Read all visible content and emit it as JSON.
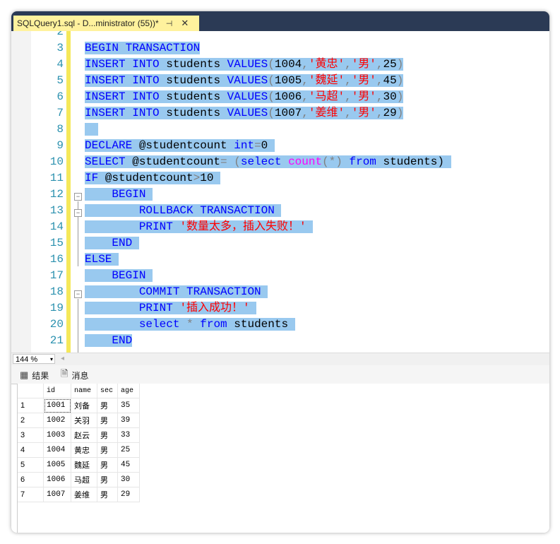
{
  "tab": {
    "title": "SQLQuery1.sql - D...ministrator (55))*",
    "pin": "⊣",
    "close": "✕"
  },
  "line_numbers": [
    "2",
    "3",
    "4",
    "5",
    "6",
    "7",
    "8",
    "9",
    "10",
    "11",
    "12",
    "13",
    "14",
    "15",
    "16",
    "17",
    "18",
    "19",
    "20",
    "21"
  ],
  "code_lines": [
    [],
    [
      {
        "t": "BEGIN TRANSACTION",
        "c": "kw",
        "s": true
      }
    ],
    [
      {
        "t": "INSERT",
        "c": "kw",
        "s": true
      },
      {
        "t": " ",
        "c": "id",
        "s": true
      },
      {
        "t": "INTO",
        "c": "kw",
        "s": true
      },
      {
        "t": " students ",
        "c": "id",
        "s": true
      },
      {
        "t": "VALUES",
        "c": "kw",
        "s": true
      },
      {
        "t": "(",
        "c": "op",
        "s": true
      },
      {
        "t": "1004",
        "c": "id",
        "s": true
      },
      {
        "t": ",",
        "c": "op",
        "s": true
      },
      {
        "t": "'黄忠'",
        "c": "str",
        "s": true
      },
      {
        "t": ",",
        "c": "op",
        "s": true
      },
      {
        "t": "'男'",
        "c": "str",
        "s": true
      },
      {
        "t": ",",
        "c": "op",
        "s": true
      },
      {
        "t": "25",
        "c": "id",
        "s": true
      },
      {
        "t": ")",
        "c": "op",
        "s": true
      }
    ],
    [
      {
        "t": "INSERT",
        "c": "kw",
        "s": true
      },
      {
        "t": " ",
        "c": "id",
        "s": true
      },
      {
        "t": "INTO",
        "c": "kw",
        "s": true
      },
      {
        "t": " students ",
        "c": "id",
        "s": true
      },
      {
        "t": "VALUES",
        "c": "kw",
        "s": true
      },
      {
        "t": "(",
        "c": "op",
        "s": true
      },
      {
        "t": "1005",
        "c": "id",
        "s": true
      },
      {
        "t": ",",
        "c": "op",
        "s": true
      },
      {
        "t": "'魏延'",
        "c": "str",
        "s": true
      },
      {
        "t": ",",
        "c": "op",
        "s": true
      },
      {
        "t": "'男'",
        "c": "str",
        "s": true
      },
      {
        "t": ",",
        "c": "op",
        "s": true
      },
      {
        "t": "45",
        "c": "id",
        "s": true
      },
      {
        "t": ")",
        "c": "op",
        "s": true
      }
    ],
    [
      {
        "t": "INSERT",
        "c": "kw",
        "s": true
      },
      {
        "t": " ",
        "c": "id",
        "s": true
      },
      {
        "t": "INTO",
        "c": "kw",
        "s": true
      },
      {
        "t": " students ",
        "c": "id",
        "s": true
      },
      {
        "t": "VALUES",
        "c": "kw",
        "s": true
      },
      {
        "t": "(",
        "c": "op",
        "s": true
      },
      {
        "t": "1006",
        "c": "id",
        "s": true
      },
      {
        "t": ",",
        "c": "op",
        "s": true
      },
      {
        "t": "'马超'",
        "c": "str",
        "s": true
      },
      {
        "t": ",",
        "c": "op",
        "s": true
      },
      {
        "t": "'男'",
        "c": "str",
        "s": true
      },
      {
        "t": ",",
        "c": "op",
        "s": true
      },
      {
        "t": "30",
        "c": "id",
        "s": true
      },
      {
        "t": ")",
        "c": "op",
        "s": true
      }
    ],
    [
      {
        "t": "INSERT",
        "c": "kw",
        "s": true
      },
      {
        "t": " ",
        "c": "id",
        "s": true
      },
      {
        "t": "INTO",
        "c": "kw",
        "s": true
      },
      {
        "t": " students ",
        "c": "id",
        "s": true
      },
      {
        "t": "VALUES",
        "c": "kw",
        "s": true
      },
      {
        "t": "(",
        "c": "op",
        "s": true
      },
      {
        "t": "1007",
        "c": "id",
        "s": true
      },
      {
        "t": ",",
        "c": "op",
        "s": true
      },
      {
        "t": "'姜维'",
        "c": "str",
        "s": true
      },
      {
        "t": ",",
        "c": "op",
        "s": true
      },
      {
        "t": "'男'",
        "c": "str",
        "s": true
      },
      {
        "t": ",",
        "c": "op",
        "s": true
      },
      {
        "t": "29",
        "c": "id",
        "s": true
      },
      {
        "t": ")",
        "c": "op",
        "s": true
      }
    ],
    [
      {
        "t": "  ",
        "c": "id",
        "s": true
      }
    ],
    [
      {
        "t": "DECLARE",
        "c": "kw",
        "s": true
      },
      {
        "t": " @studentcount ",
        "c": "id",
        "s": true
      },
      {
        "t": "int",
        "c": "kw",
        "s": true
      },
      {
        "t": "=",
        "c": "op",
        "s": true
      },
      {
        "t": "0 ",
        "c": "id",
        "s": true
      }
    ],
    [
      {
        "t": "SELECT",
        "c": "kw",
        "s": true
      },
      {
        "t": " @studentcount",
        "c": "id",
        "s": true
      },
      {
        "t": "= (",
        "c": "op",
        "s": true
      },
      {
        "t": "select",
        "c": "kw",
        "s": true
      },
      {
        "t": " ",
        "c": "id",
        "s": true
      },
      {
        "t": "count",
        "c": "fn",
        "s": true
      },
      {
        "t": "(*)",
        "c": "op",
        "s": true
      },
      {
        "t": " ",
        "c": "id",
        "s": true
      },
      {
        "t": "from",
        "c": "kw",
        "s": true
      },
      {
        "t": " students) ",
        "c": "id",
        "s": true
      }
    ],
    [
      {
        "t": "IF",
        "c": "kw",
        "s": true
      },
      {
        "t": " @studentcount",
        "c": "id",
        "s": true
      },
      {
        "t": ">",
        "c": "op",
        "s": true
      },
      {
        "t": "10 ",
        "c": "id",
        "s": true
      }
    ],
    [
      {
        "t": "    ",
        "c": "id",
        "s": true
      },
      {
        "t": "BEGIN",
        "c": "kw",
        "s": true
      },
      {
        "t": " ",
        "c": "id",
        "s": true
      }
    ],
    [
      {
        "t": "        ",
        "c": "id",
        "s": true
      },
      {
        "t": "ROLLBACK TRANSACTION",
        "c": "kw",
        "s": true
      },
      {
        "t": " ",
        "c": "id",
        "s": true
      }
    ],
    [
      {
        "t": "        ",
        "c": "id",
        "s": true
      },
      {
        "t": "PRINT",
        "c": "kw",
        "s": true
      },
      {
        "t": " ",
        "c": "id",
        "s": true
      },
      {
        "t": "'数量太多，插入失败！'",
        "c": "str",
        "s": true
      },
      {
        "t": " ",
        "c": "id",
        "s": true
      }
    ],
    [
      {
        "t": "    ",
        "c": "id",
        "s": true
      },
      {
        "t": "END",
        "c": "kw",
        "s": true
      },
      {
        "t": " ",
        "c": "id",
        "s": true
      }
    ],
    [
      {
        "t": "ELSE",
        "c": "kw",
        "s": true
      },
      {
        "t": " ",
        "c": "id",
        "s": true
      }
    ],
    [
      {
        "t": "    ",
        "c": "id",
        "s": true
      },
      {
        "t": "BEGIN",
        "c": "kw",
        "s": true
      },
      {
        "t": " ",
        "c": "id",
        "s": true
      }
    ],
    [
      {
        "t": "        ",
        "c": "id",
        "s": true
      },
      {
        "t": "COMMIT TRANSACTION",
        "c": "kw",
        "s": true
      },
      {
        "t": " ",
        "c": "id",
        "s": true
      }
    ],
    [
      {
        "t": "        ",
        "c": "id",
        "s": true
      },
      {
        "t": "PRINT",
        "c": "kw",
        "s": true
      },
      {
        "t": " ",
        "c": "id",
        "s": true
      },
      {
        "t": "'插入成功！'",
        "c": "str",
        "s": true
      },
      {
        "t": " ",
        "c": "id",
        "s": true
      }
    ],
    [
      {
        "t": "        ",
        "c": "id",
        "s": true
      },
      {
        "t": "select",
        "c": "kw",
        "s": true
      },
      {
        "t": " ",
        "c": "id",
        "s": true
      },
      {
        "t": "*",
        "c": "op",
        "s": true
      },
      {
        "t": " ",
        "c": "id",
        "s": true
      },
      {
        "t": "from",
        "c": "kw",
        "s": true
      },
      {
        "t": " students ",
        "c": "id",
        "s": true
      }
    ],
    [
      {
        "t": "    ",
        "c": "id",
        "s": true
      },
      {
        "t": "END",
        "c": "kw",
        "s": true
      }
    ]
  ],
  "zoom": {
    "value": "144 %",
    "arrow": "▾",
    "scroll_left": "◂"
  },
  "results_tabs": [
    {
      "icon": "▦",
      "label": "结果"
    },
    {
      "icon": "🗎",
      "label": "消息"
    }
  ],
  "grid": {
    "columns": [
      "id",
      "name",
      "sec",
      "age"
    ],
    "rows": [
      [
        "1",
        "1001",
        "刘备",
        "男",
        "35"
      ],
      [
        "2",
        "1002",
        "关羽",
        "男",
        "39"
      ],
      [
        "3",
        "1003",
        "赵云",
        "男",
        "33"
      ],
      [
        "4",
        "1004",
        "黄忠",
        "男",
        "25"
      ],
      [
        "5",
        "1005",
        "魏延",
        "男",
        "45"
      ],
      [
        "6",
        "1006",
        "马超",
        "男",
        "30"
      ],
      [
        "7",
        "1007",
        "姜维",
        "男",
        "29"
      ]
    ]
  }
}
